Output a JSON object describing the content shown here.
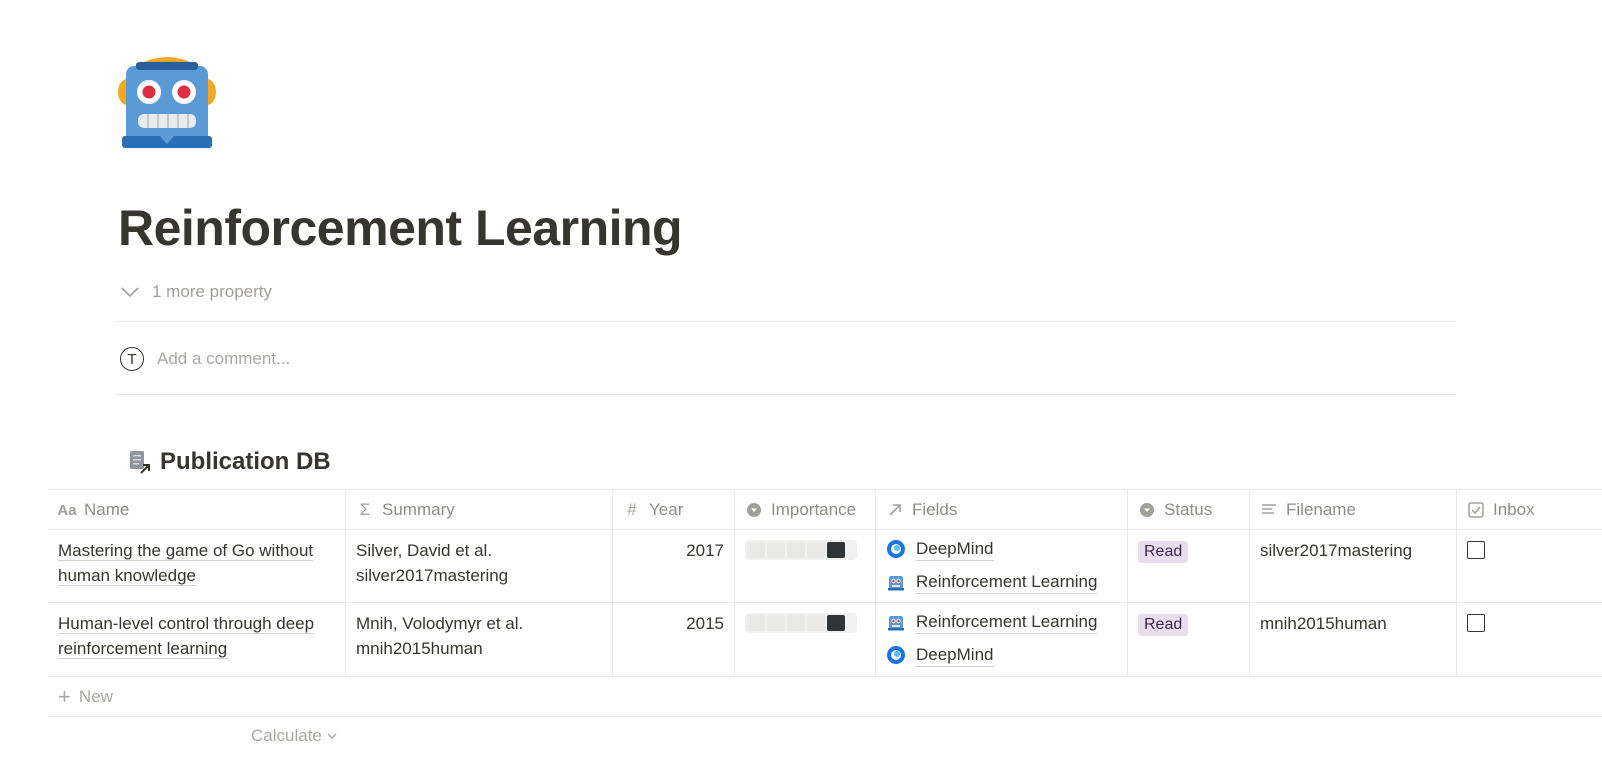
{
  "page": {
    "icon": "robot-face-icon",
    "title": "Reinforcement Learning",
    "more_properties": "1 more property",
    "comment": {
      "avatar_initial": "T",
      "placeholder": "Add a comment..."
    }
  },
  "database": {
    "icon": "linked-page-icon",
    "title": "Publication DB",
    "columns": [
      {
        "icon": "text-aa-icon",
        "label": "Name"
      },
      {
        "icon": "sigma-icon",
        "label": "Summary"
      },
      {
        "icon": "hash-icon",
        "label": "Year"
      },
      {
        "icon": "select-icon",
        "label": "Importance"
      },
      {
        "icon": "relation-arrow-icon",
        "label": "Fields"
      },
      {
        "icon": "select-icon",
        "label": "Status"
      },
      {
        "icon": "lines-icon",
        "label": "Filename"
      },
      {
        "icon": "checkbox-icon",
        "label": "Inbox"
      }
    ],
    "rows": [
      {
        "name_line1": "Mastering the game of Go without",
        "name_line2": "human knowledge",
        "summary_line1": "Silver, David et al.",
        "summary_line2": "silver2017mastering",
        "year": "2017",
        "importance": 5,
        "fields": [
          {
            "icon": "deepmind-icon",
            "label": "DeepMind"
          },
          {
            "icon": "robot-face-icon",
            "label": "Reinforcement Learning"
          }
        ],
        "status": "Read",
        "filename": "silver2017mastering",
        "inbox": false
      },
      {
        "name_line1": "Human-level control through deep",
        "name_line2": "reinforcement learning",
        "summary_line1": "Mnih, Volodymyr et al.",
        "summary_line2": "mnih2015human",
        "year": "2015",
        "importance": 5,
        "fields": [
          {
            "icon": "robot-face-icon",
            "label": "Reinforcement Learning"
          },
          {
            "icon": "deepmind-icon",
            "label": "DeepMind"
          }
        ],
        "status": "Read",
        "filename": "mnih2015human",
        "inbox": false
      }
    ],
    "new_label": "New",
    "calculate_label": "Calculate"
  },
  "colors": {
    "text": "#37352f",
    "muted": "#a19f9a",
    "border": "#ebeae7",
    "status_read_bg": "#e8deee",
    "status_read_text": "#412454",
    "importance_filled": "#2f3437"
  }
}
